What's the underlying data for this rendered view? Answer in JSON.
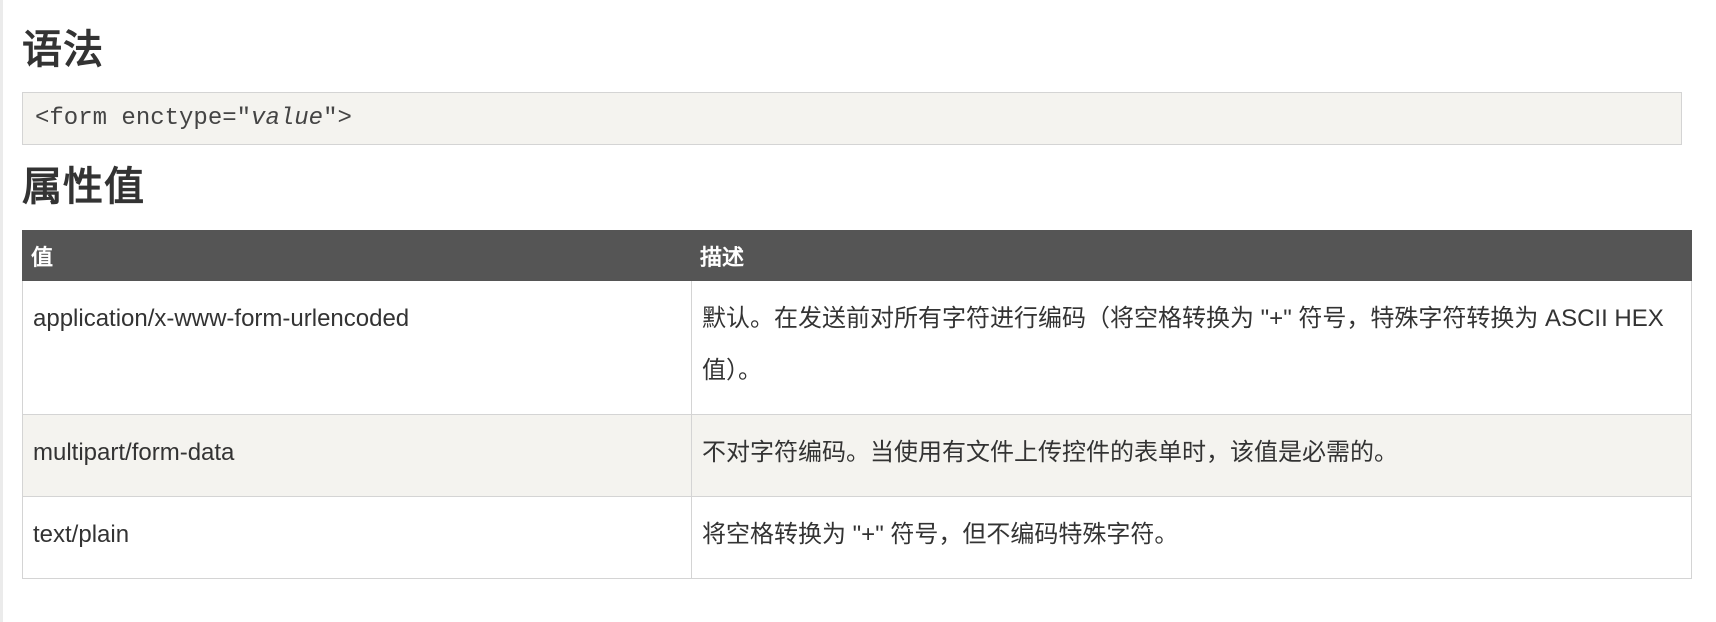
{
  "syntax": {
    "heading": "语法",
    "code_prefix": "<form enctype=\"",
    "code_param": "value",
    "code_suffix": "\">"
  },
  "attribute_values": {
    "heading": "属性值",
    "columns": [
      "值",
      "描述"
    ],
    "rows": [
      {
        "value": "application/x-www-form-urlencoded",
        "description": "默认。在发送前对所有字符进行编码（将空格转换为 \"+\" 符号，特殊字符转换为 ASCII HEX 值）。"
      },
      {
        "value": "multipart/form-data",
        "description": "不对字符编码。当使用有文件上传控件的表单时，该值是必需的。"
      },
      {
        "value": "text/plain",
        "description": "将空格转换为 \"+\" 符号，但不编码特殊字符。"
      }
    ]
  },
  "colors": {
    "header_bg": "#555555",
    "alt_row_bg": "#f4f3ef",
    "code_bg": "#f4f3ef",
    "border": "#d4d4d4",
    "text": "#333333"
  }
}
